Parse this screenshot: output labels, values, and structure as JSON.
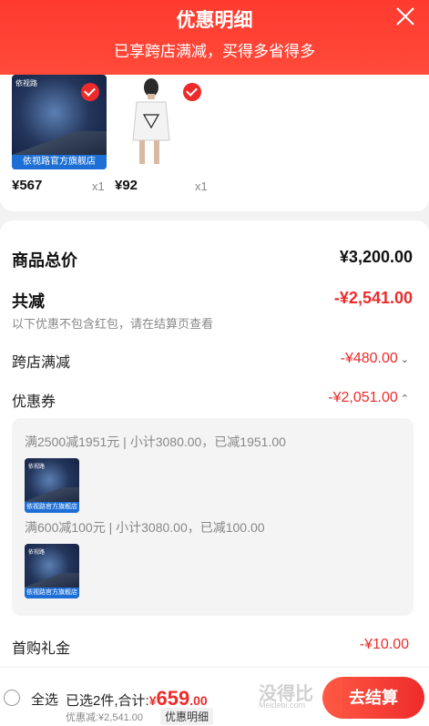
{
  "header": {
    "title": "优惠明细",
    "subtitle": "已享跨店满减，买得多省得多"
  },
  "products": [
    {
      "store_tag": "依视路官方旗舰店",
      "price": "¥567",
      "qty": "x1"
    },
    {
      "price": "¥92",
      "qty": "x1"
    }
  ],
  "summary": {
    "total_label": "商品总价",
    "total_value": "¥3,200.00",
    "reduction_label": "共减",
    "reduction_value": "-¥2,541.00",
    "note": "以下优惠不包含红包，请在结算页查看",
    "cross_store_label": "跨店满减",
    "cross_store_value": "-¥480.00",
    "coupon_label": "优惠券",
    "coupon_value": "-¥2,051.00",
    "first_gift_label": "首购礼金",
    "first_gift_value": "-¥10.00"
  },
  "coupons": [
    {
      "text": "满2500减1951元 | 小计3080.00，已减1951.00",
      "store_tag": "依视路官方旗舰店"
    },
    {
      "text": "满600减100元 | 小计3080.00，已减100.00",
      "store_tag": "依视路官方旗舰店"
    }
  ],
  "bottom_bar": {
    "select_all": "全选",
    "selected_count": "已选2件,合计:",
    "currency": "¥",
    "total_int": "659",
    "total_dec": ".00",
    "discount": "优惠减:¥2,541.00",
    "detail_tag": "优惠明细",
    "checkout": "去结算",
    "watermark": "没得比",
    "watermark_sub": "Meidebi.com"
  },
  "colors": {
    "brand_red": "#ee2b2b",
    "header_red": "#ff3a2f",
    "coupon_bg": "#f4f4f4"
  }
}
